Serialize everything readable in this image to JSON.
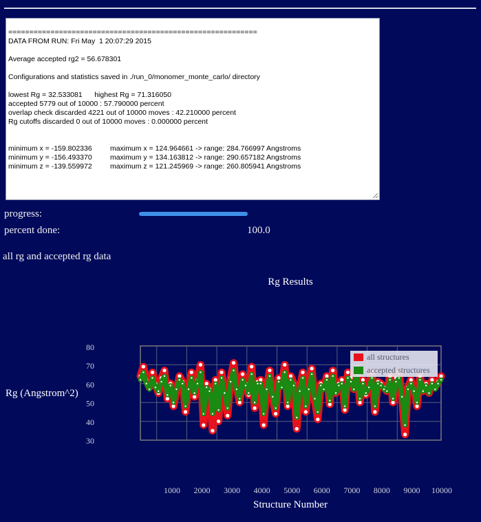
{
  "output": {
    "lines": [
      "===========================================================",
      "DATA FROM RUN: Fri May  1 20:07:29 2015",
      "",
      "Average accepted rg2 = 56.678301",
      "",
      "Configurations and statistics saved in ./run_0/monomer_monte_carlo/ directory",
      "",
      "lowest Rg = 32.533081      highest Rg = 71.316050",
      "accepted 5779 out of 10000 : 57.790000 percent",
      "overlap check discarded 4221 out of 10000 moves : 42.210000 percent",
      "Rg cutoffs discarded 0 out of 10000 moves : 0.000000 percent",
      "",
      "",
      "minimum x = -159.802336         maximum x = 124.964661 -> range: 284.766997 Angstroms",
      "minimum y = -156.493370         maximum y = 134.163812 -> range: 290.657182 Angstroms",
      "minimum z = -139.559972         maximum z = 121.245969 -> range: 260.805941 Angstroms",
      "",
      "",
      "",
      "==========================================================="
    ]
  },
  "progress": {
    "label": "progress:",
    "fraction": 1.0,
    "percent_label": "percent done:",
    "percent_value": "100.0"
  },
  "section_title": "all rg and accepted rg data",
  "colors": {
    "background": "#00095a",
    "all_structures": "#e8121c",
    "accepted_structures": "#1a8a12",
    "progress": "#3f8fe8"
  },
  "chart_data": {
    "type": "scatter",
    "title": "Rg Results",
    "xlabel": "Structure Number",
    "ylabel": "Rg (Angstrom^2)",
    "xlim": [
      0,
      10000
    ],
    "ylim": [
      30,
      80
    ],
    "x_ticks": [
      "1000",
      "2000",
      "3000",
      "4000",
      "5000",
      "6000",
      "7000",
      "8000",
      "9000",
      "10000"
    ],
    "y_ticks": [
      "80",
      "70",
      "60",
      "50",
      "40",
      "30"
    ],
    "grid": true,
    "legend_position": "top-right",
    "series": [
      {
        "name": "all structures",
        "color": "#e8121c",
        "x": [
          0,
          100,
          200,
          300,
          400,
          500,
          600,
          700,
          800,
          900,
          1000,
          1100,
          1200,
          1300,
          1400,
          1500,
          1600,
          1700,
          1800,
          1900,
          2000,
          2100,
          2200,
          2300,
          2400,
          2500,
          2600,
          2700,
          2800,
          2900,
          3000,
          3100,
          3200,
          3300,
          3400,
          3500,
          3600,
          3700,
          3800,
          3900,
          4000,
          4100,
          4200,
          4300,
          4400,
          4500,
          4600,
          4700,
          4800,
          4900,
          5000,
          5100,
          5200,
          5300,
          5400,
          5500,
          5600,
          5700,
          5800,
          5900,
          6000,
          6100,
          6200,
          6300,
          6400,
          6500,
          6600,
          6700,
          6800,
          6900,
          7000,
          7100,
          7200,
          7300,
          7400,
          7500,
          7600,
          7700,
          7800,
          7900,
          8000,
          8100,
          8200,
          8300,
          8400,
          8500,
          8600,
          8700,
          8800,
          8900,
          9000,
          9100,
          9200,
          9300,
          9400,
          9500,
          9600,
          9700,
          9800,
          9900,
          10000
        ],
        "y": [
          64,
          69,
          62,
          58,
          66,
          60,
          55,
          63,
          67,
          52,
          60,
          48,
          56,
          64,
          61,
          45,
          58,
          66,
          53,
          62,
          70,
          38,
          60,
          57,
          35,
          62,
          40,
          66,
          55,
          43,
          63,
          71,
          58,
          50,
          65,
          60,
          54,
          69,
          47,
          61,
          62,
          38,
          58,
          67,
          52,
          44,
          63,
          59,
          70,
          48,
          64,
          60,
          36,
          57,
          66,
          45,
          58,
          68,
          51,
          41,
          60,
          58,
          64,
          49,
          67,
          55,
          60,
          62,
          46,
          66,
          63,
          57,
          68,
          50,
          62,
          54,
          59,
          66,
          45,
          61,
          60,
          58,
          56,
          64,
          50,
          63,
          66,
          52,
          33,
          58,
          62,
          57,
          48,
          64,
          56,
          60,
          55,
          62,
          58,
          61,
          64
        ]
      },
      {
        "name": "accepted structures",
        "color": "#1a8a12",
        "x": [
          0,
          100,
          200,
          300,
          400,
          500,
          600,
          700,
          800,
          900,
          1000,
          1100,
          1200,
          1300,
          1400,
          1500,
          1600,
          1700,
          1800,
          1900,
          2000,
          2100,
          2200,
          2300,
          2400,
          2500,
          2600,
          2700,
          2800,
          2900,
          3000,
          3100,
          3200,
          3300,
          3400,
          3500,
          3600,
          3700,
          3800,
          3900,
          4000,
          4100,
          4200,
          4300,
          4400,
          4500,
          4600,
          4700,
          4800,
          4900,
          5000,
          5100,
          5200,
          5300,
          5400,
          5500,
          5600,
          5700,
          5800,
          5900,
          6000,
          6100,
          6200,
          6300,
          6400,
          6500,
          6600,
          6700,
          6800,
          6900,
          7000,
          7100,
          7200,
          7300,
          7400,
          7500,
          7600,
          7700,
          7800,
          7900,
          8000,
          8100,
          8200,
          8300,
          8400,
          8500,
          8600,
          8700,
          8800,
          8900,
          9000,
          9100,
          9200,
          9300,
          9400,
          9500,
          9600,
          9700,
          9800,
          9900,
          10000
        ],
        "y": [
          62,
          66,
          60,
          57,
          63,
          58,
          56,
          61,
          64,
          54,
          59,
          50,
          57,
          62,
          60,
          48,
          57,
          63,
          55,
          60,
          66,
          44,
          58,
          56,
          44,
          60,
          46,
          63,
          55,
          47,
          61,
          67,
          57,
          52,
          62,
          59,
          55,
          65,
          50,
          60,
          60,
          44,
          57,
          64,
          53,
          47,
          61,
          58,
          66,
          50,
          62,
          59,
          42,
          56,
          63,
          48,
          57,
          65,
          52,
          45,
          59,
          57,
          62,
          51,
          64,
          55,
          59,
          60,
          48,
          63,
          61,
          57,
          65,
          52,
          60,
          55,
          58,
          63,
          48,
          60,
          59,
          57,
          56,
          62,
          52,
          61,
          63,
          53,
          38,
          57,
          60,
          56,
          50,
          62,
          56,
          59,
          55,
          60,
          57,
          60,
          62
        ]
      }
    ]
  }
}
